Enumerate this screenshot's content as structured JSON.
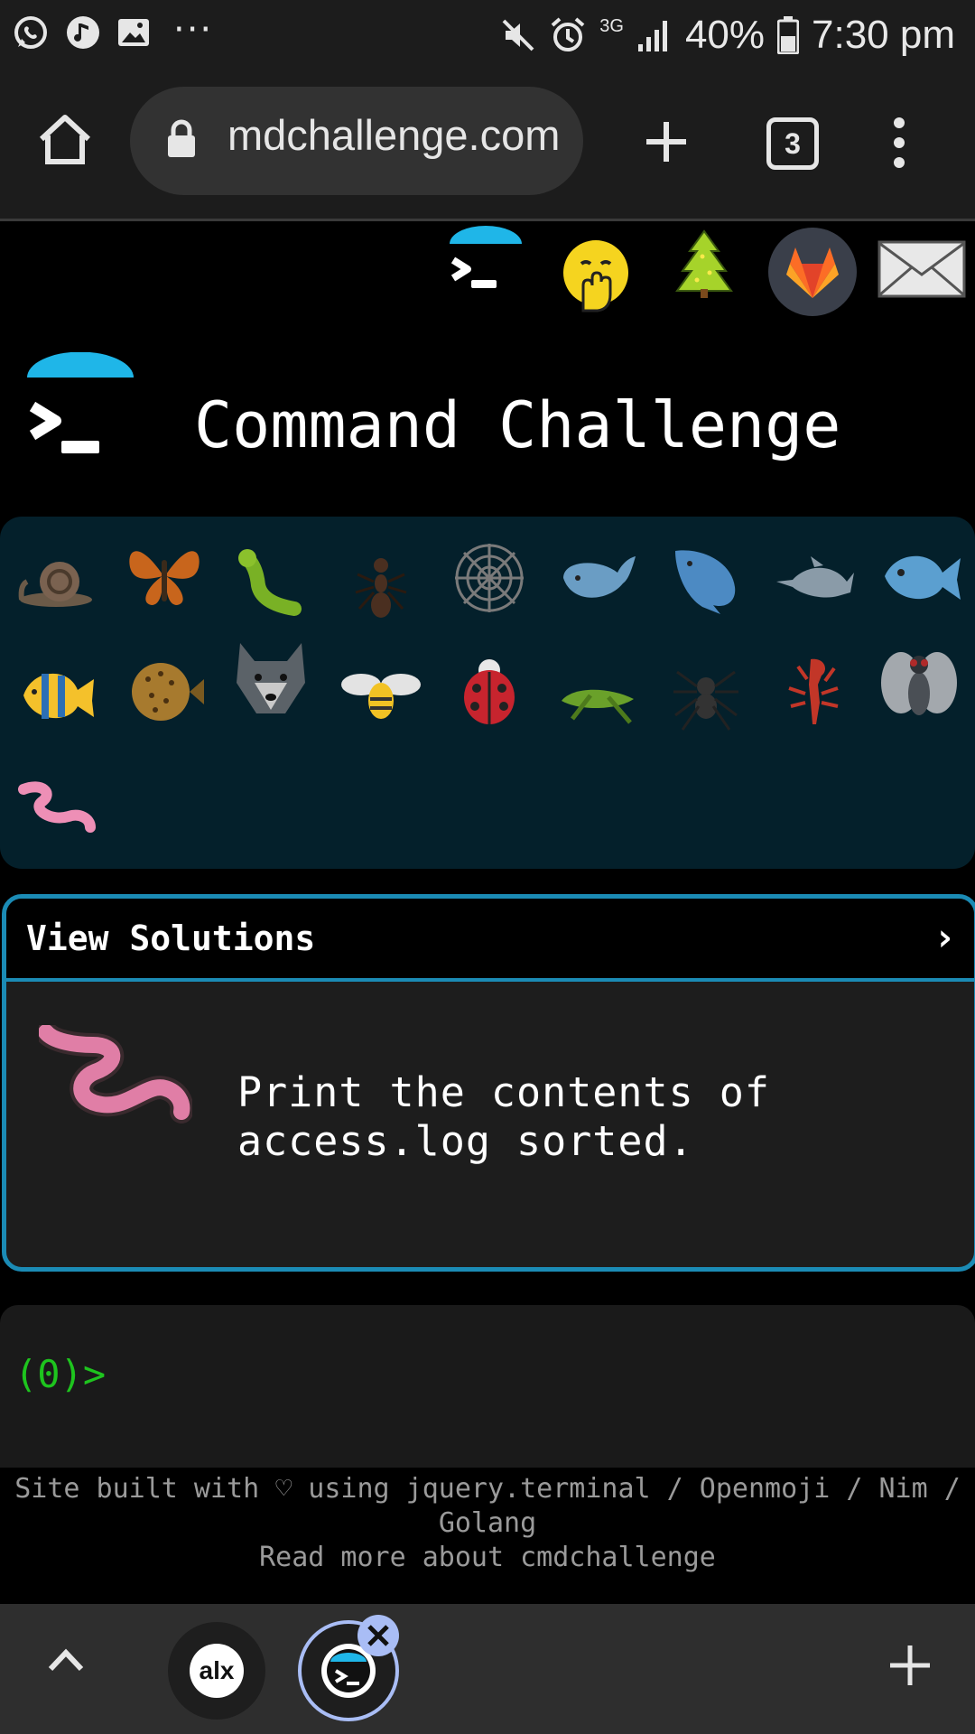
{
  "status_bar": {
    "signal_label": "3G",
    "battery": "40%",
    "time": "7:30 pm",
    "icons": [
      "whatsapp-icon",
      "music-icon",
      "gallery-icon",
      "more-dots-icon",
      "mute-icon",
      "alarm-icon",
      "signal-icon",
      "battery-icon"
    ]
  },
  "browser": {
    "url": "mdchallenge.com",
    "tab_count": "3"
  },
  "header_icons": [
    "cmdchallenge-icon",
    "hand-over-mouth-emoji-icon",
    "tree-icon",
    "gitlab-icon",
    "mail-icon"
  ],
  "site": {
    "title": "Command Challenge"
  },
  "creatures": [
    "snail",
    "butterfly",
    "caterpillar",
    "ant",
    "spider-web",
    "whale",
    "whale-2",
    "dolphin",
    "fish",
    "tropical-fish",
    "blowfish",
    "wolf",
    "bee",
    "ladybug",
    "cricket",
    "spider",
    "scorpion",
    "fly",
    "worm"
  ],
  "challenge": {
    "header": "View Solutions",
    "chevron": "›",
    "text": "Print the contents of access.log sorted."
  },
  "terminal": {
    "prompt": "(0)>"
  },
  "footer": {
    "line1": "Site built with ♡ using jquery.terminal / Openmoji / Nim / Golang",
    "line2": "Read more about cmdchallenge"
  },
  "bottom_bar": {
    "alx_label": "alx"
  },
  "colors": {
    "accent": "#1b8bb5",
    "prompt_green": "#1ec41e",
    "panel_bg": "#04202b"
  }
}
